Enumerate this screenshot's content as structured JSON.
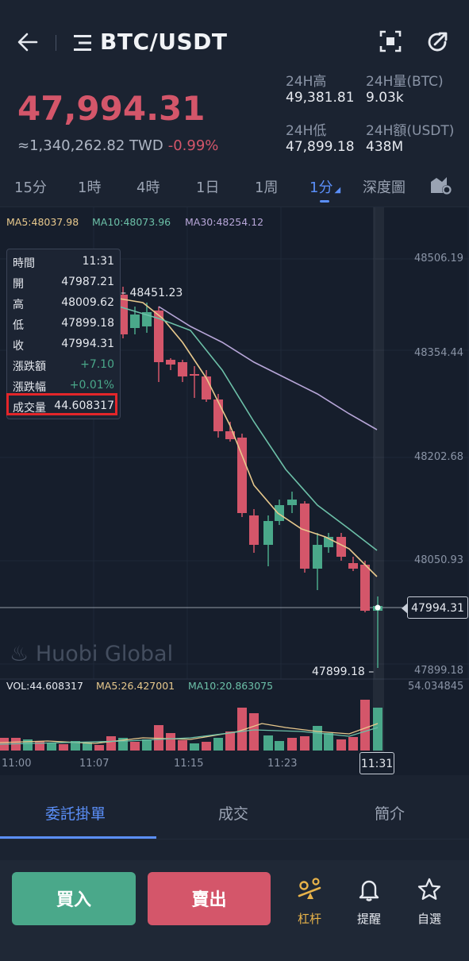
{
  "header": {
    "pair": "BTC/USDT"
  },
  "ticker": {
    "last_price": "47,994.31",
    "twd_value": "≈1,340,262.82 TWD",
    "change_pct": "-0.99%",
    "stats": [
      {
        "label": "24H高",
        "value": "49,381.81"
      },
      {
        "label": "24H量(BTC)",
        "value": "9.03k"
      },
      {
        "label": "24H低",
        "value": "47,899.18"
      },
      {
        "label": "24H額(USDT)",
        "value": "438M"
      }
    ]
  },
  "intervals": [
    {
      "label": "15分",
      "active": false
    },
    {
      "label": "1時",
      "active": false
    },
    {
      "label": "4時",
      "active": false
    },
    {
      "label": "1日",
      "active": false
    },
    {
      "label": "1周",
      "active": false
    },
    {
      "label": "1分",
      "active": true
    },
    {
      "label": "深度圖",
      "active": false
    }
  ],
  "chart": {
    "ma_labels": {
      "ma5": "MA5:48037.98",
      "ma10": "MA10:48073.96",
      "ma30": "MA30:48254.12"
    },
    "y_ticks": [
      "48506.19",
      "48354.44",
      "48202.68",
      "48050.93",
      "47899.18"
    ],
    "high_marker": "48451.23",
    "low_marker": "47899.18",
    "current_price_tag": "47994.31",
    "watermark": "Huobi Global",
    "tooltip": [
      {
        "label": "時間",
        "value": "11:31"
      },
      {
        "label": "開",
        "value": "47987.21"
      },
      {
        "label": "高",
        "value": "48009.62"
      },
      {
        "label": "低",
        "value": "47899.18"
      },
      {
        "label": "收",
        "value": "47994.31"
      },
      {
        "label": "漲跌額",
        "value": "+7.10"
      },
      {
        "label": "漲跌幅",
        "value": "+0.01%"
      },
      {
        "label": "成交量",
        "value": "44.608317"
      }
    ],
    "volume_labels": {
      "vol": "VOL:44.608317",
      "ma5": "MA5:26.427001",
      "ma10": "MA10:20.863075",
      "max": "54.034845"
    },
    "x_ticks": [
      "11:00",
      "11:07",
      "11:15",
      "11:23"
    ],
    "crosshair_time": "11:31",
    "colors": {
      "up": "#4aa88a",
      "down": "#d4566a",
      "ma5": "#e8c98d",
      "ma10": "#6cc0a8",
      "ma30": "#b7a6d8",
      "accent": "#5b8ff9"
    }
  },
  "bottom_tabs": [
    {
      "label": "委託掛單",
      "active": true
    },
    {
      "label": "成交",
      "active": false
    },
    {
      "label": "簡介",
      "active": false
    }
  ],
  "footer": {
    "buy": "買入",
    "sell": "賣出",
    "leverage": "杠杆",
    "alert": "提醒",
    "favorite": "自選"
  }
}
